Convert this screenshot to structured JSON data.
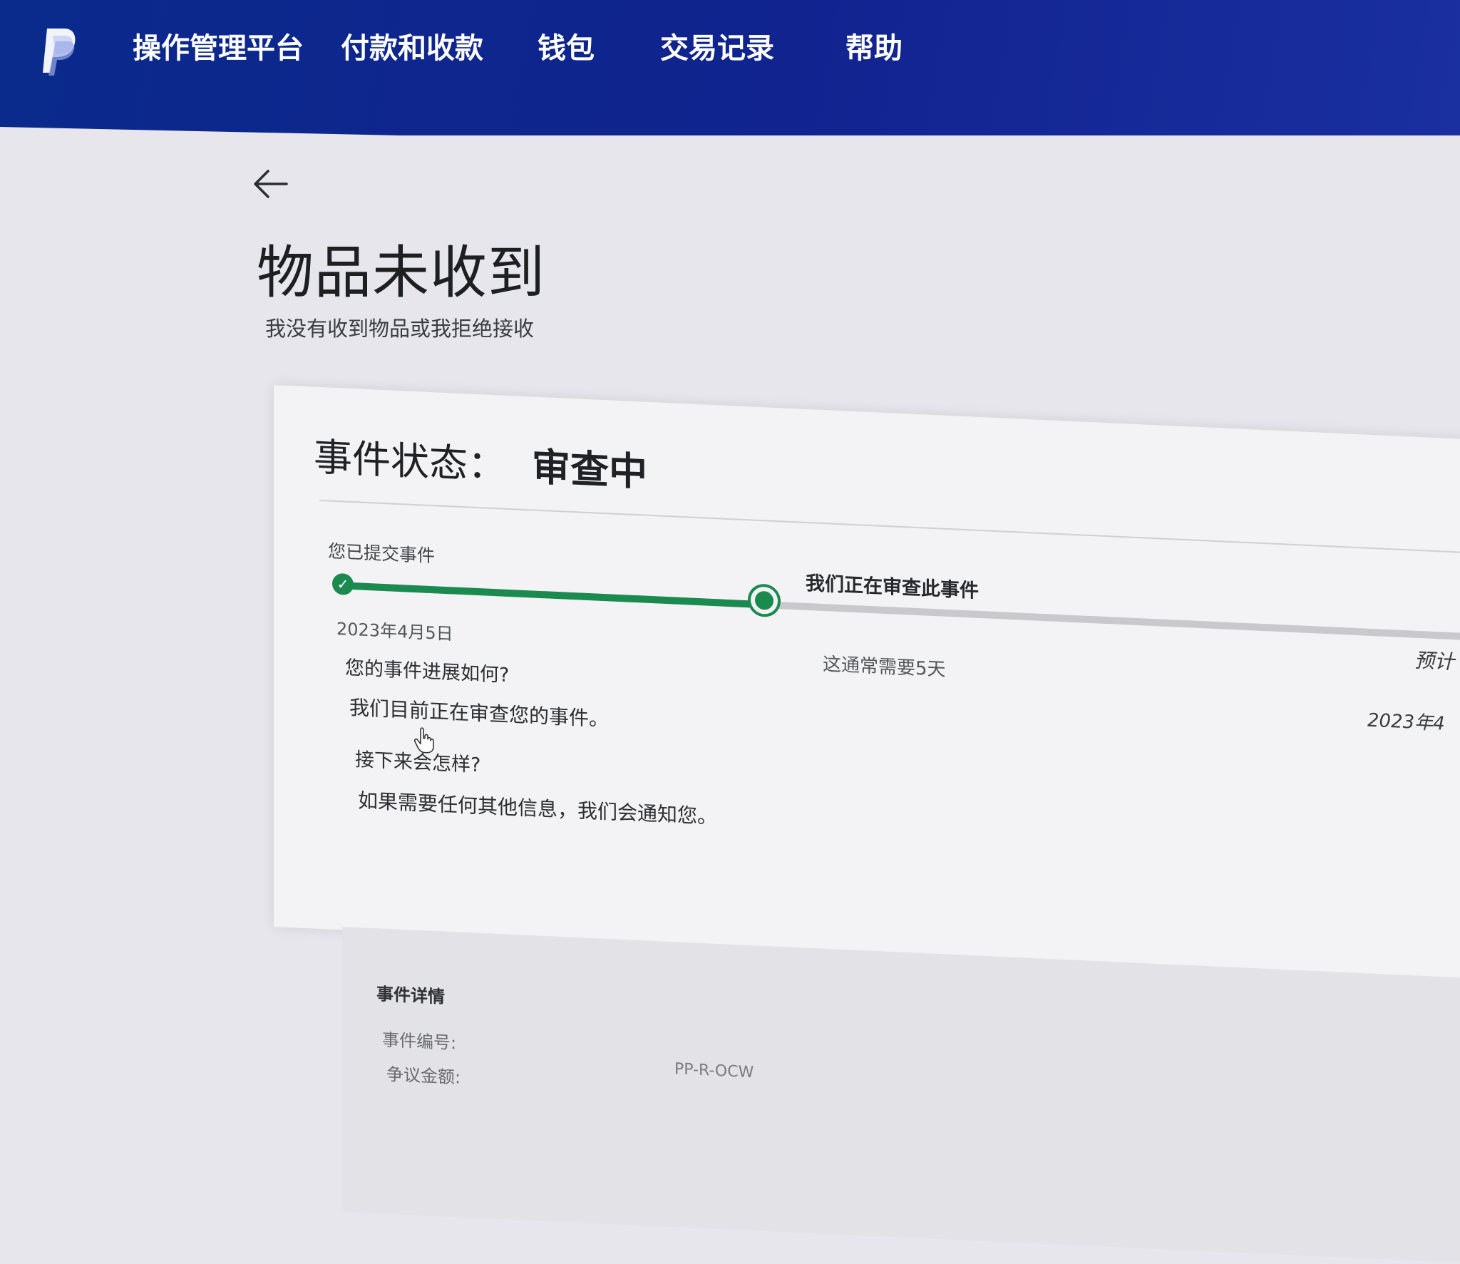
{
  "nav": {
    "items": [
      {
        "label": "操作管理平台"
      },
      {
        "label": "付款和收款"
      },
      {
        "label": "钱包"
      },
      {
        "label": "交易记录"
      },
      {
        "label": "帮助"
      }
    ]
  },
  "page": {
    "title": "物品未收到",
    "subtitle": "我没有收到物品或我拒绝接收"
  },
  "status": {
    "label": "事件状态：",
    "value": "审查中"
  },
  "timeline": {
    "progress": 0.37,
    "steps": [
      {
        "label": "您已提交事件",
        "date": "2023年4月5日",
        "state": "done"
      },
      {
        "label": "我们正在审查此事件",
        "note": "这通常需要5天",
        "state": "current"
      },
      {
        "label": "预计",
        "date": "2023年4",
        "state": "pending"
      }
    ]
  },
  "progress_info": {
    "q1": "您的事件进展如何?",
    "a1": "我们目前正在审查您的事件。",
    "q2": "接下来会怎样?",
    "a2": "如果需要任何其他信息，我们会通知您。"
  },
  "details": {
    "title": "事件详情",
    "labels": [
      "事件编号:",
      "争议金额:"
    ],
    "value": "PP-R-OCW"
  },
  "colors": {
    "nav_bg": "#11238f",
    "progress_green": "#1a8a4f",
    "track_gray": "#c9c9cd"
  }
}
